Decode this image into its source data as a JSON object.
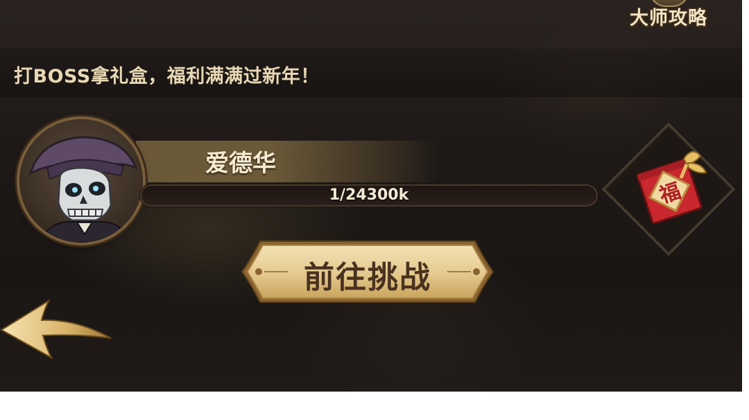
{
  "header": {
    "guide_label": "大师攻略"
  },
  "event": {
    "banner_text": "打BOSS拿礼盒，福利满满过新年！"
  },
  "boss": {
    "name": "爱德华",
    "hp_text": "1/24300k",
    "hp_fraction": 0
  },
  "reward": {
    "gift_character": "福"
  },
  "actions": {
    "challenge_label": "前往挑战"
  },
  "icons": {
    "back": "back-arrow-icon",
    "reward": "gift-box-icon",
    "portrait": "skeleton-pirate-avatar"
  },
  "colors": {
    "banner_text": "#e8d8b4",
    "button_gold": "#e7cf97",
    "gift_red": "#c8282e"
  }
}
